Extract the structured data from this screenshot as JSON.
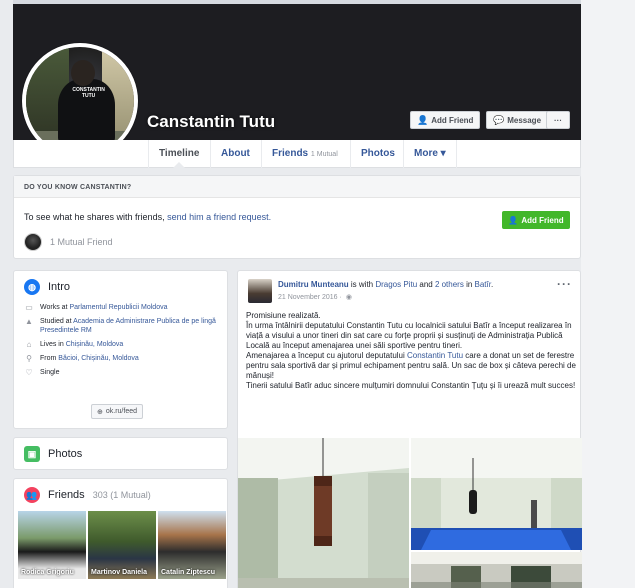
{
  "profile": {
    "name": "Canstantin Tutu",
    "shirt_text": "CONSTANTIN TUTU"
  },
  "header_buttons": {
    "add_friend": "Add Friend",
    "message": "Message",
    "more": "···"
  },
  "tabs": [
    {
      "label": "Timeline"
    },
    {
      "label": "About"
    },
    {
      "label": "Friends",
      "badge": "1 Mutual"
    },
    {
      "label": "Photos"
    },
    {
      "label": "More ▾"
    }
  ],
  "dyk": {
    "title": "DO YOU KNOW CANSTANTIN?",
    "text_prefix": "To see what he shares with friends, ",
    "text_link": "send him a friend request.",
    "add_button": "Add Friend",
    "mutual": "1 Mutual Friend"
  },
  "intro": {
    "title": "Intro",
    "items": [
      {
        "icon": "briefcase-icon",
        "prefix": "Works at ",
        "link": "Parlamentul Republicii Moldova"
      },
      {
        "icon": "graduation-cap-icon",
        "prefix": "Studied at ",
        "link": "Academia de Administrare Publica de pe lingă Presedintele RM"
      },
      {
        "icon": "home-icon",
        "prefix": "Lives in ",
        "link": "Chișinău, Moldova"
      },
      {
        "icon": "location-pin-icon",
        "prefix": "From ",
        "link": "Băcioi, Chișinău, Moldova"
      },
      {
        "icon": "heart-icon",
        "prefix": "Single",
        "link": ""
      }
    ],
    "website": "ok.ru/feed"
  },
  "photos": {
    "title": "Photos"
  },
  "friends": {
    "title": "Friends",
    "count": "303 (1 Mutual)",
    "items": [
      {
        "name": "Rodica Grigoriu"
      },
      {
        "name": "Martinov Daniela"
      },
      {
        "name": "Catalin Ziptescu"
      }
    ]
  },
  "post": {
    "author": "Dumitru Munteanu",
    "with_text": " is with ",
    "with_person": "Dragos Pitu",
    "and_text": " and ",
    "others": "2 others",
    "in_text": " in ",
    "place": "Batîr",
    "date": "21 November 2016 · ",
    "menu": "···",
    "paragraphs": [
      "Promisiune realizată.",
      "În urma întâlnirii deputatului Constantin Tutu cu localnicii satului Batîr a început realizarea în viață a visului a unor tineri din sat care cu forțe proprii și susținuți de Administrația Publică Locală au început amenajarea unei săli sportive pentru tineri.",
      "Amenajarea a început cu ajutorul deputatului ",
      "Tinerii satului Batîr aduc sincere mulțumiri domnului Constantin Țuțu și îi urează mult succes!"
    ],
    "p3_link": "Constantin Tutu",
    "p3_rest": " care a donat un set de ferestre pentru sala sportivă dar și primul echipament pentru sală. Un sac de box și câteva perechi de mănuși!"
  },
  "colors": {
    "fb_blue": "#365899",
    "green": "#42b72a",
    "intro_icon": "#1877f2",
    "photos_icon": "#45bd62",
    "friends_icon": "#f3425f"
  }
}
